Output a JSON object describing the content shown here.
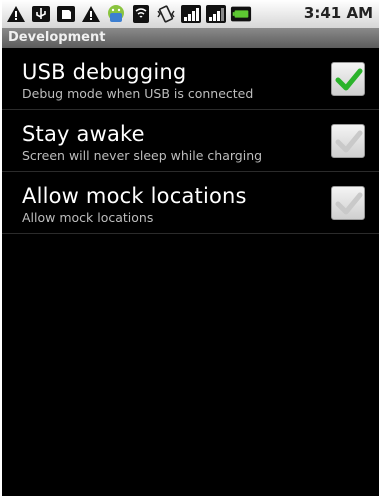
{
  "status_bar": {
    "icons": [
      "warning-icon",
      "usb-icon",
      "sd-card-icon",
      "warning-icon",
      "android-icon",
      "wifi-icon",
      "vibrate-icon",
      "signal-icon",
      "signal-icon",
      "battery-icon"
    ],
    "time": "3:41 AM"
  },
  "header": {
    "title": "Development"
  },
  "settings": [
    {
      "title": "USB debugging",
      "summary": "Debug mode when USB is connected",
      "checked": true
    },
    {
      "title": "Stay awake",
      "summary": "Screen will never sleep while charging",
      "checked": false
    },
    {
      "title": "Allow mock locations",
      "summary": "Allow mock locations",
      "checked": false
    }
  ],
  "colors": {
    "check_on": "#2bb32b",
    "check_off": "#c9c9c9",
    "background": "#000000"
  }
}
